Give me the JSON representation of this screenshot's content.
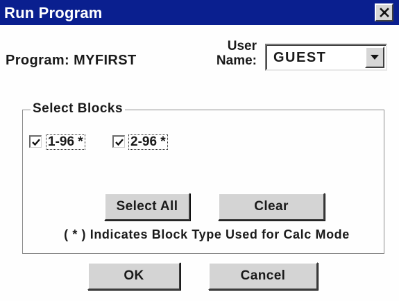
{
  "window": {
    "title": "Run Program",
    "close_icon": "close-x-icon"
  },
  "program": {
    "label": "Program:  MYFIRST"
  },
  "user": {
    "label_line1": "User",
    "label_line2": "Name:",
    "selected_value": "GUEST",
    "dropdown_icon": "chevron-down-icon"
  },
  "blocks": {
    "group_title": "Select Blocks",
    "items": [
      {
        "label": "1-96 *",
        "checked": true
      },
      {
        "label": "2-96 *",
        "checked": true
      }
    ],
    "select_all_label": "Select All",
    "clear_label": "Clear",
    "note": "( * )  Indicates Block Type Used for Calc Mode"
  },
  "footer": {
    "ok_label": "OK",
    "cancel_label": "Cancel"
  },
  "colors": {
    "titlebar": "#0a1f8f",
    "face": "#d4d4d4",
    "background": "#fefefe"
  }
}
